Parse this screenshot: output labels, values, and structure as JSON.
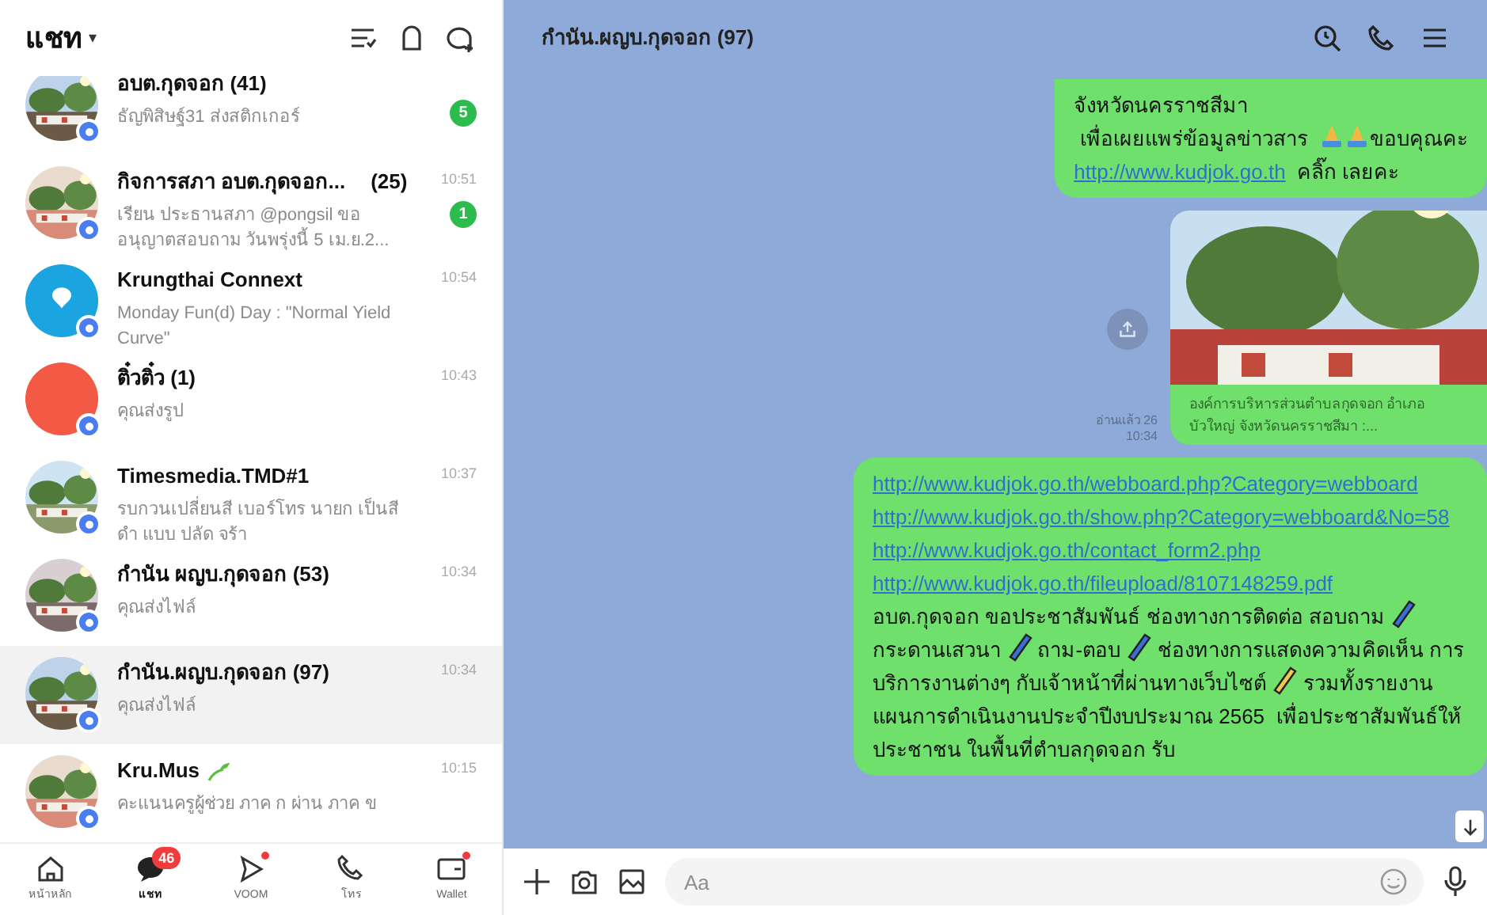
{
  "sidebar": {
    "title": "แชท",
    "caret": "▾",
    "chats": [
      {
        "name": "อบต.กุดจอก (41)",
        "preview": "ธัญพิสิษฐ์31 ส่งสติกเกอร์",
        "unread": "5",
        "selected": false
      },
      {
        "name": "กิจการสภา อบต.กุดจอก...",
        "count": "(25)",
        "preview": "เรียน ประธานสภา @pongsil  ขออนุญาตสอบถาม วันพรุ่งนี้ 5 เม.ย.2...",
        "time": "10:51",
        "unread": "1",
        "selected": false
      },
      {
        "name": "Krungthai Connext",
        "preview": "Monday Fun(d) Day : \"Normal Yield Curve\"",
        "time": "10:54",
        "avatar": {
          "kind": "logo",
          "color": "#1ba5e0"
        },
        "selected": false
      },
      {
        "name": "ติ๋วติ๋ว (1)",
        "preview": "คุณส่งรูป",
        "time": "10:43",
        "avatar": {
          "kind": "plain",
          "color": "#f25a46"
        },
        "selected": false
      },
      {
        "name": "Timesmedia.TMD#1",
        "preview": "รบกวนเปลี่ยนสี เบอร์โทร นายก เป็นสีดำ แบบ ปลัด จร้า",
        "time": "10:37",
        "selected": false
      },
      {
        "name": "กำนัน ผญบ.กุดจอก (53)",
        "preview": "คุณส่งไฟล์",
        "time": "10:34",
        "selected": false
      },
      {
        "name": "กำนัน.ผญบ.กุดจอก (97)",
        "preview": "คุณส่งไฟล์",
        "time": "10:34",
        "selected": true
      },
      {
        "name": "Kru.Mus",
        "sprout": true,
        "preview": "คะแนนครูผู้ช่วย  ภาค ก ผ่าน ภาค ข",
        "time": "10:15",
        "selected": false
      }
    ],
    "nav": [
      {
        "kind": "home",
        "label": "หน้าหลัก",
        "selected": false
      },
      {
        "kind": "chat",
        "label": "แชท",
        "badge": "46",
        "selected": true
      },
      {
        "kind": "voom",
        "label": "VOOM",
        "dot": true,
        "selected": false
      },
      {
        "kind": "call",
        "label": "โทร",
        "selected": false
      },
      {
        "kind": "wallet",
        "label": "Wallet",
        "dot": true,
        "selected": false
      }
    ]
  },
  "chat": {
    "title": "กำนัน.ผญบ.กุดจอก (97)",
    "messages": [
      {
        "kind": "text",
        "paragraphs": [
          [
            {
              "kind": "text",
              "text": "จังหวัดนครราชสีมา"
            }
          ],
          [
            {
              "kind": "text",
              "text": " เพื่อเผยแพร่ข้อมูลข่าวสาร  "
            },
            {
              "kind": "hands"
            },
            {
              "kind": "hands"
            },
            {
              "kind": "text",
              "text": "ขอบคุณคะ"
            }
          ],
          [
            {
              "kind": "link",
              "text": "http://www.kudjok.go.th"
            },
            {
              "kind": "text",
              "text": "  คลิ๊ก เลยคะ"
            }
          ]
        ]
      },
      {
        "kind": "card",
        "caption": "องค์การบริหารส่วนตำบลกุดจอก  อำเภอบัวใหญ่ จังหวัดนครราชสีมา :...",
        "read": "อ่านแล้ว 26",
        "time": "10:34"
      },
      {
        "kind": "text",
        "paragraphs": [
          [
            {
              "kind": "link",
              "text": "http://www.kudjok.go.th/webboard.php?Category=webboard"
            }
          ],
          [
            {
              "kind": "link",
              "text": "http://www.kudjok.go.th/show.php?Category=webboard&No=58"
            }
          ],
          [
            {
              "kind": "link",
              "text": "http://www.kudjok.go.th/contact_form2.php"
            }
          ],
          [
            {
              "kind": "link",
              "text": "http://www.kudjok.go.th/fileupload/8107148259.pdf"
            }
          ],
          [
            {
              "kind": "text",
              "text": "อบต.กุดจอก ขอประชาสัมพันธ์ ช่องทางการติดต่อ สอบถาม "
            },
            {
              "kind": "pencil",
              "color": "#3a6fd8"
            },
            {
              "kind": "text",
              "text": " กระดานเสวนา "
            },
            {
              "kind": "pencil",
              "color": "#3a6fd8"
            },
            {
              "kind": "text",
              "text": " ถาม-ตอบ "
            },
            {
              "kind": "pencil",
              "color": "#3a6fd8"
            },
            {
              "kind": "text",
              "text": " ช่องทางการแสดงความคิดเห็น การบริการงานต่างๆ กับเจ้าหน้าที่ผ่านทางเว็บไซต์ "
            },
            {
              "kind": "pencil",
              "color": "#f2c94c"
            },
            {
              "kind": "text",
              "text": " รวมทั้งรายงานแผนการดำเนินงานประจำปีงบประมาณ 2565  เพื่อประชาสัมพันธ์ให้ประชาชน ในพื้นที่ตำบลกุดจอก รับ"
            }
          ]
        ]
      }
    ]
  },
  "composer": {
    "placeholder": "Aa"
  }
}
